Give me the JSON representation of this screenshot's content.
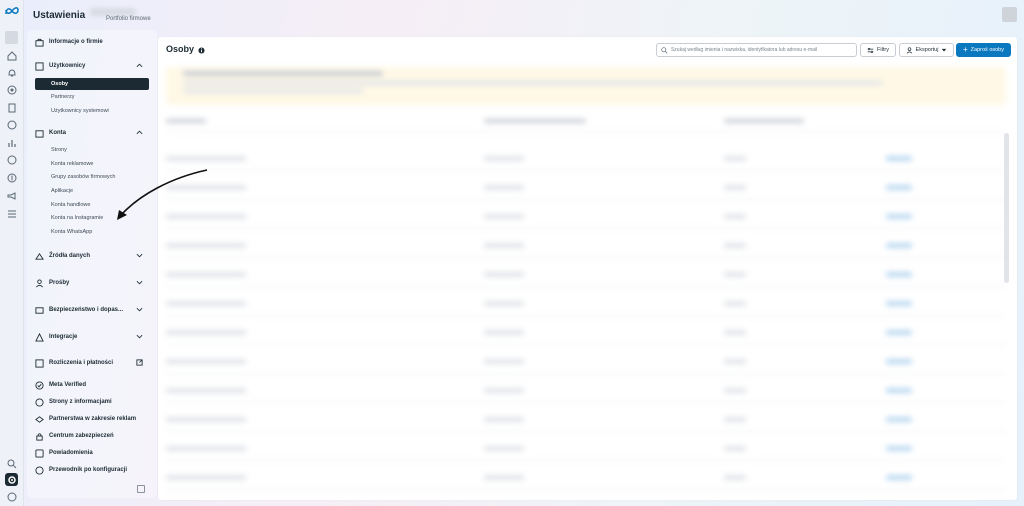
{
  "header": {
    "title": "Ustawienia",
    "portfolio_subtitle": "Portfolio firmowe"
  },
  "sidebar": {
    "company_info": "Informacje o firmie",
    "users_section": "Użytkownicy",
    "users_items": [
      "Osoby",
      "Partnerzy",
      "Użytkownicy systemowi"
    ],
    "accounts_section": "Konta",
    "accounts_items": [
      "Strony",
      "Konta reklamowe",
      "Grupy zasobów firmowych",
      "Aplikacje",
      "Konta handlowe",
      "Konta na Instagramie",
      "Konta WhatsApp"
    ],
    "data_sources": "Źródła danych",
    "requests": "Prośby",
    "security": "Bezpieczeństwo i dopas...",
    "integrations": "Integracje",
    "billing": "Rozliczenia i płatności",
    "meta_verified": "Meta Verified",
    "info_pages": "Strony z informacjami",
    "ad_partnerships": "Partnerstwa w zakresie reklam",
    "security_center": "Centrum zabezpieczeń",
    "notifications": "Powiadomienia",
    "setup_guide": "Przewodnik po konfiguracji"
  },
  "main": {
    "title": "Osoby",
    "search_placeholder": "Szukaj według imienia i nazwiska, identyfikatora lub adresu e-mail",
    "filters_label": "Filtry",
    "export_label": "Eksportuj",
    "invite_label": "Zaproś osoby"
  },
  "colors": {
    "primary": "#0a78be",
    "selected_bg": "#1c2b33",
    "text": "#1c2b33"
  }
}
